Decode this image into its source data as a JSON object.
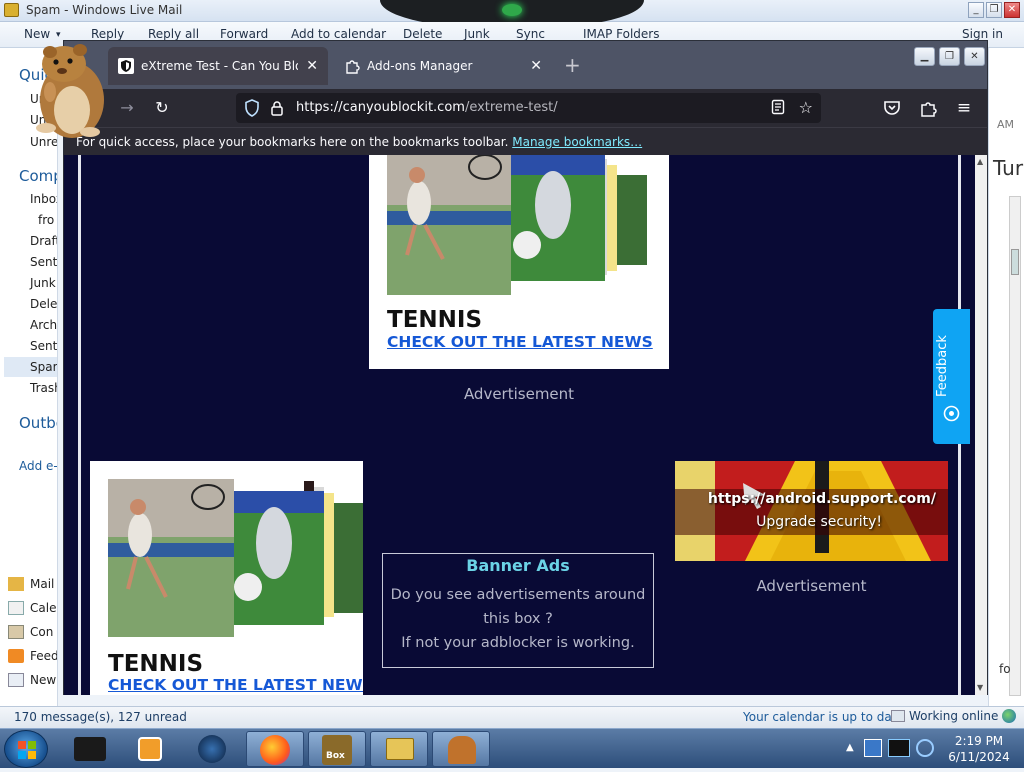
{
  "wlm": {
    "title": "Spam - Windows Live Mail",
    "toolbar": [
      "New",
      "Reply",
      "Reply all",
      "Forward",
      "Add to calendar",
      "Delete",
      "Junk",
      "Sync",
      "IMAP Folders"
    ],
    "sign_in": "Sign in",
    "nav": {
      "quick_views": "Quick",
      "quick_items": [
        "Unre",
        "Unre",
        "Unre"
      ],
      "computer": "Comp",
      "folders": [
        "Inbox",
        "fro",
        "Draft",
        "Sent",
        "Junk",
        "Delet",
        "Archi",
        "Sent",
        "Spam",
        "Trash"
      ],
      "outbox": "Outbo",
      "add_account": "Add e-",
      "apps": [
        "Mail",
        "Cale",
        "Con",
        "Feed",
        "New"
      ]
    },
    "right_pane": {
      "time_fragment": "AM",
      "big_text": "Tur",
      "bottom": "fo"
    },
    "status": {
      "messages": "170 message(s), 127 unread",
      "calendar": "Your calendar is up to date",
      "online": "Working online"
    }
  },
  "firefox": {
    "tabs": [
      {
        "label": "eXtreme Test - Can You Block It",
        "active": true
      },
      {
        "label": "Add-ons Manager",
        "active": false
      }
    ],
    "url": {
      "domain": "https://canyoublockit.com",
      "path": "/extreme-test/"
    },
    "bookmarks_bar": {
      "text": "For quick access, place your bookmarks here on the bookmarks toolbar.",
      "link": "Manage bookmarks…"
    }
  },
  "page": {
    "ad1": {
      "title": "TENNIS",
      "link": "CHECK OUT THE LATEST NEWS",
      "caption": "Advertisement"
    },
    "ad2": {
      "title": "TENNIS",
      "link": "CHECK OUT THE LATEST NEWS"
    },
    "banner_box": {
      "heading": "Banner Ads",
      "line1": "Do you see advertisements around",
      "line2": "this box ?",
      "line3": "If not your adblocker is working."
    },
    "warning_ad": {
      "url": "https://android.support.com/",
      "subtitle": "Upgrade security!",
      "caption": "Advertisement"
    },
    "feedback": "Feedback"
  },
  "taskbar": {
    "time": "2:19 PM",
    "date": "6/11/2024",
    "box_label": "Box"
  },
  "colors": {
    "page_bg": "#090a35",
    "banner_heading": "#6bd3e6",
    "link": "#1558d6",
    "feedback": "#0fa4f3"
  }
}
